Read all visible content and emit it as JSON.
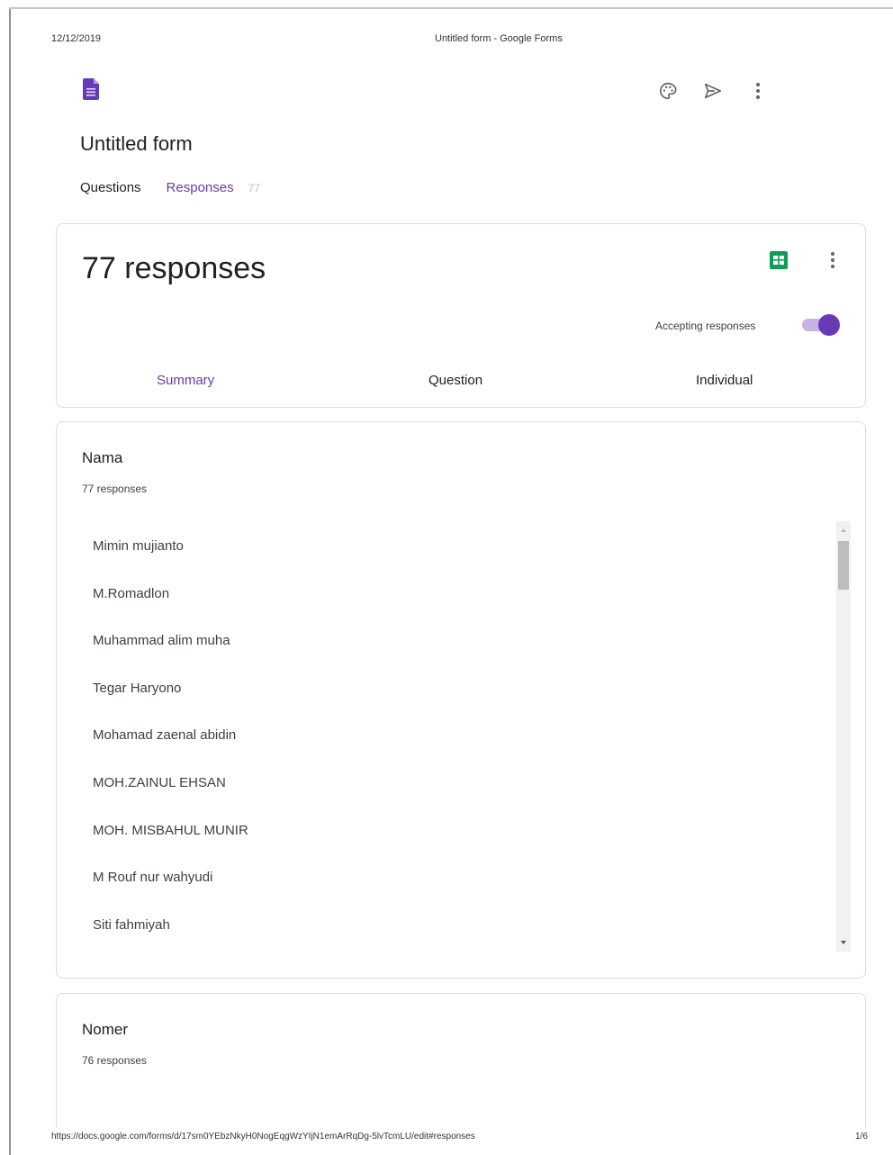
{
  "print_header": {
    "date": "12/12/2019",
    "title": "Untitled form - Google Forms"
  },
  "print_footer": {
    "url": "https://docs.google.com/forms/d/17sm0YEbzNkyH0NogEqgWzYIjN1emArRqDg-5lvTcmLU/edit#responses",
    "page": "1/6"
  },
  "form": {
    "title": "Untitled form",
    "tabs": [
      {
        "label": "Questions"
      },
      {
        "label": "Responses",
        "count": "77"
      }
    ]
  },
  "header_icons": [
    "palette-icon",
    "send-icon",
    "more-vert-icon"
  ],
  "responses_card": {
    "count_label": "77 responses",
    "accepting_label": "Accepting responses",
    "accepting": true,
    "subtabs": [
      "Summary",
      "Question",
      "Individual"
    ],
    "active_subtab": "Summary"
  },
  "questions": [
    {
      "title": "Nama",
      "count_label": "77 responses",
      "answers": [
        "Mimin mujianto",
        "M.Romadlon",
        "Muhammad alim muha",
        "Tegar Haryono",
        "Mohamad zaenal abidin",
        "MOH.ZAINUL EHSAN",
        "MOH. MISBAHUL MUNIR",
        "M Rouf nur wahyudi",
        "Siti fahmiyah"
      ]
    },
    {
      "title": "Nomer",
      "count_label": "76 responses"
    }
  ],
  "colors": {
    "accent": "#673ab7",
    "sheets_green": "#0f9d58"
  }
}
